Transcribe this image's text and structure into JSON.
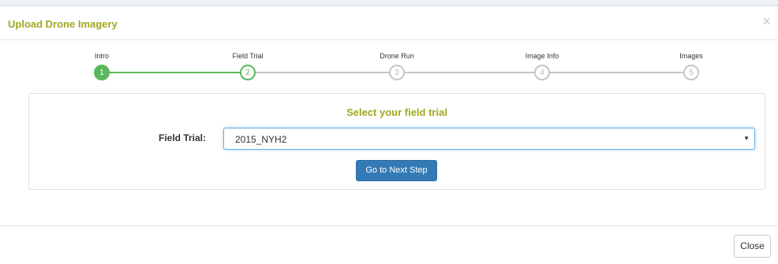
{
  "modal": {
    "title": "Upload Drone Imagery",
    "close_glyph": "×"
  },
  "steps": [
    {
      "label": "Intro",
      "number": "1",
      "state": "done"
    },
    {
      "label": "Field Trial",
      "number": "2",
      "state": "active"
    },
    {
      "label": "Drone Run",
      "number": "3",
      "state": "todo"
    },
    {
      "label": "Image Info",
      "number": "4",
      "state": "todo"
    },
    {
      "label": "Images",
      "number": "5",
      "state": "todo"
    }
  ],
  "panel": {
    "title": "Select your field trial",
    "field_label": "Field Trial:",
    "field_value": "2015_NYH2",
    "next_button": "Go to Next Step"
  },
  "footer": {
    "close_button": "Close"
  },
  "colors": {
    "title_accent": "#a0a81f",
    "step_done": "#5cb85c",
    "step_todo": "#c5c5c5",
    "primary_button": "#337ab7"
  }
}
